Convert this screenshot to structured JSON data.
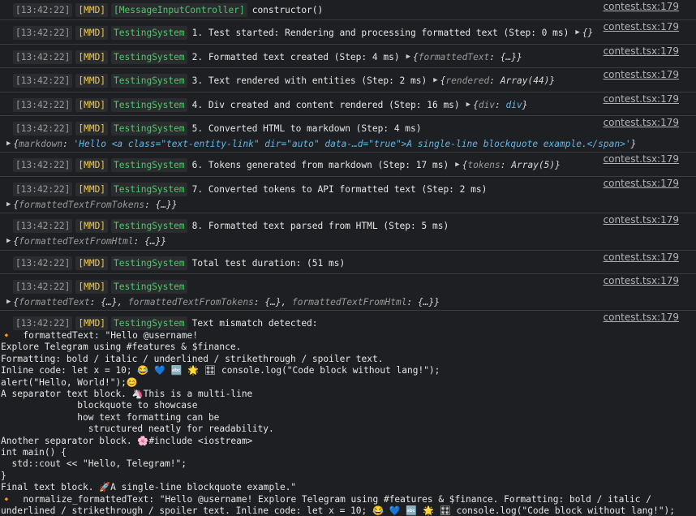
{
  "source_link": "contest.tsx:179",
  "timestamp": "[13:42:22]",
  "mmd_tag": "[MMD]",
  "system_tag": "TestingSystem",
  "first_row": {
    "tag": "[MessageInputController]",
    "message": "constructor()"
  },
  "rows": [
    {
      "message": "1. Test started: Rendering and processing formatted text (Step: 0 ms)",
      "inline_obj": "{}"
    },
    {
      "message": "2. Formatted text created (Step: 4 ms)",
      "inline_key": "formattedText",
      "inline_val": "{…}"
    },
    {
      "message": "3. Text rendered with entities (Step: 2 ms)",
      "inline_key": "rendered",
      "inline_val": "Array(44)"
    },
    {
      "message": "4. Div created and content rendered (Step: 16 ms)",
      "inline_key": "div",
      "inline_val": "div"
    },
    {
      "message": "5. Converted HTML to markdown (Step: 4 ms)",
      "sub_key": "markdown",
      "sub_val": "'Hello <a class=\"text-entity-link\" dir=\"auto\" data-…d=\"true\">A single-line blockquote example.</span>'"
    },
    {
      "message": "6. Tokens generated from markdown (Step: 17 ms)",
      "inline_key": "tokens",
      "inline_val": "Array(5)"
    },
    {
      "message": "7. Converted tokens to API formatted text (Step: 2 ms)",
      "sub_key": "formattedTextFromTokens",
      "sub_val": "{…}"
    },
    {
      "message": "8. Formatted text parsed from HTML (Step: 5 ms)",
      "sub_key": "formattedTextFromHtml",
      "sub_val": "{…}"
    },
    {
      "message": "Total test duration: (51 ms)"
    }
  ],
  "summary_row": {
    "k1": "formattedText",
    "v1": "{…}",
    "k2": "formattedTextFromTokens",
    "v2": "{…}",
    "k3": "formattedTextFromHtml",
    "v3": "{…}"
  },
  "mismatch_row": {
    "message": "Text mismatch detected:",
    "bullet": "🔸",
    "body": "formattedText: \"Hello @username!\nExplore Telegram using #features & $finance.\nFormatting: bold / italic / underlined / strikethrough / spoiler text.\nInline code: let x = 10; 😂 💙 🔤 🌟 🎛 console.log(\"Code block without lang!\");\nalert(\"Hello, World!\");😊\nA separator text block. 🦄This is a multi-line\n              blockquote to showcase\n              how text formatting can be\n                structured neatly for readability.\nAnother separator block. 🌸#include <iostream>\nint main() {\n  std::cout << \"Hello, Telegram!\";\n}\nFinal text block. 🚀A single-line blockquote example.\"",
    "body2": "normalize_formattedText: \"Hello @username! Explore Telegram using #features & $finance. Formatting: bold / italic /\nunderlined / strikethrough / spoiler text. Inline code: let x = 10; 😂 💙 🔤 🌟 🎛 console.log(\"Code block without lang!\");"
  }
}
